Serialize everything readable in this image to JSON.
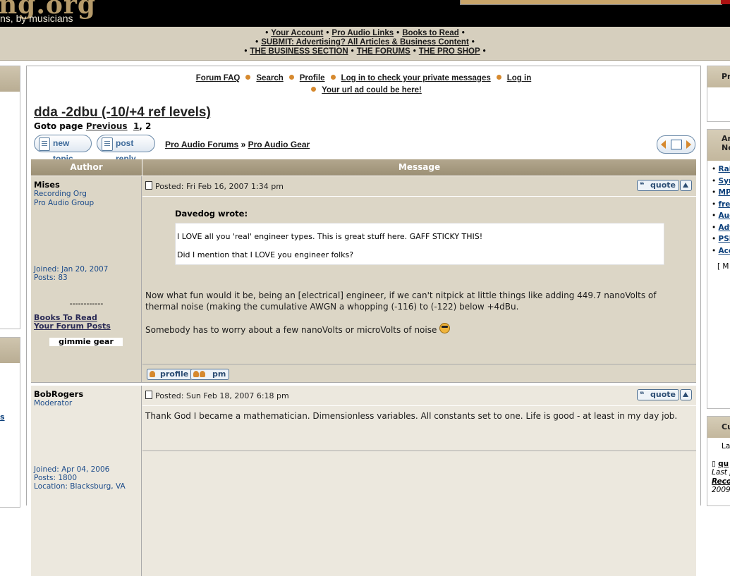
{
  "site": {
    "logo_text": "ng.org",
    "tagline": "ns, by musicians"
  },
  "nav": {
    "row1": [
      "Your Account",
      "Pro Audio Links",
      "Books to Read"
    ],
    "row2": [
      "SUBMIT: Advertising? All Articles & Business Content"
    ],
    "row3": [
      "THE BUSINESS SECTION",
      "THE FORUMS",
      "THE PRO SHOP"
    ]
  },
  "forum_links": {
    "faq": "Forum FAQ",
    "search": "Search",
    "profile": "Profile",
    "login_pm": "Log in to check your private messages",
    "login": "Log in",
    "ad": "Your url ad could be here!"
  },
  "topic": {
    "title": "dda -2dbu (-10/+4 ref levels)",
    "goto_label": "Goto page",
    "previous": "Previous",
    "page1": "1",
    "page2": "2",
    "new_topic": "new topic",
    "post_reply": "post reply",
    "crumb_forum": "Pro Audio Forums",
    "crumb_sep": "»",
    "crumb_sub": "Pro Audio Gear"
  },
  "table": {
    "col_author": "Author",
    "col_message": "Message"
  },
  "posts": [
    {
      "author": "Mises",
      "rank1": "Recording Org",
      "rank2": "Pro Audio Group",
      "joined": "Joined: Jan 20, 2007",
      "posts": "Posts: 83",
      "divider": "------------",
      "link1": "Books To Read",
      "link2": "Your Forum Posts",
      "gear": "gimmie gear",
      "posted": "Posted: Fri Feb 16, 2007 1:34 pm",
      "quote_author": "Davedog wrote:",
      "quote_line1": "I LOVE all you 'real' engineer types. This is great stuff here. GAFF STICKY THIS!",
      "quote_line2": "Did I mention that I LOVE you engineer folks?",
      "body1": "Now what fun would it be, being an [electrical] engineer, if we can't nitpick at little things like adding 449.7 nanoVolts of thermal noise (making the cumulative AWGN a whopping (-116) to (-122) below +4dBu.",
      "body2": "Somebody has to worry about a few nanoVolts or microVolts of noise",
      "quote_btn": "quote",
      "profile_btn": "profile",
      "pm_btn": "pm"
    },
    {
      "author": "BobRogers",
      "rank1": "Moderator",
      "joined": "Joined: Apr 04, 2006",
      "posts": "Posts: 1800",
      "location": "Location: Blacksburg, VA",
      "posted": "Posted: Sun Feb 18, 2007 6:18 pm",
      "body1": "Thank God I became a mathematician. Dimensionless variables. All constants set to one. Life is good - at least in my day job.",
      "quote_btn": "quote"
    }
  ],
  "right_sidebar": {
    "box1_title": "Pr",
    "box2_title_1": "Ar",
    "box2_title_2": "Ne",
    "items": [
      "Rai FREE Supp Warr",
      "Syn Real Instr Softw",
      "MP",
      "free abou",
      "Aud Spot",
      "Adv Peac Barr Insu",
      "PSI from",
      "Aco & So by A"
    ],
    "more": "[ M",
    "box3_title": "Cu",
    "box3_line1": "La",
    "box3_item": "qu",
    "box3_last": "Last p",
    "box3_reco": "Reco",
    "box3_year": "2009"
  },
  "left_sidebar": {
    "link": "s"
  }
}
